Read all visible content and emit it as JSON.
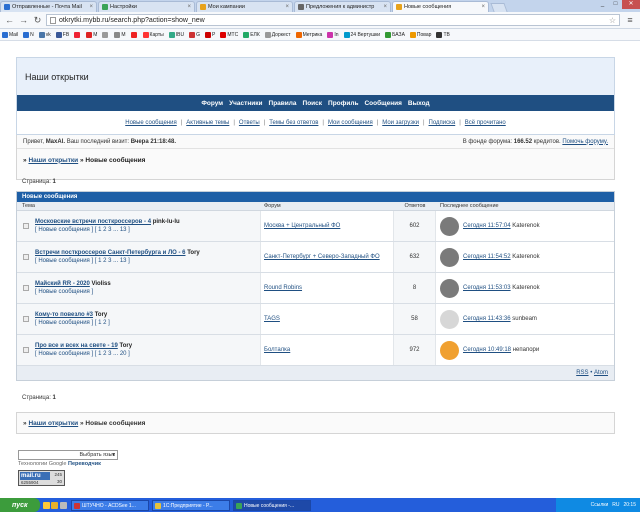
{
  "tabs": [
    {
      "label": "Отправленные - Почта Mail",
      "color": "#2a6ed1"
    },
    {
      "label": "Настройки",
      "color": "#3aa357"
    },
    {
      "label": "Мои кампании",
      "color": "#e7a21b"
    },
    {
      "label": "Предложения к администр",
      "color": "#666666"
    },
    {
      "label": "Новые сообщения",
      "color": "#e7a21b"
    }
  ],
  "address": "otkrytki.mybb.ru/search.php?action=show_new",
  "bookmarks": [
    {
      "label": "Mail",
      "color": "#2a6ed1"
    },
    {
      "label": "N",
      "color": "#2a6ed1"
    },
    {
      "label": "vk",
      "color": "#4a76a8"
    },
    {
      "label": "FB",
      "color": "#3b5998"
    },
    {
      "label": "",
      "color": "#e23"
    },
    {
      "label": "М",
      "color": "#d22"
    },
    {
      "label": "",
      "color": "#999"
    },
    {
      "label": "М",
      "color": "#888"
    },
    {
      "label": "",
      "color": "#e22"
    },
    {
      "label": "Карты",
      "color": "#f33"
    },
    {
      "label": "IBU",
      "color": "#3a8"
    },
    {
      "label": "G",
      "color": "#c33"
    },
    {
      "label": "P",
      "color": "#c00"
    },
    {
      "label": "MTC",
      "color": "#d00"
    },
    {
      "label": "ЕЛК",
      "color": "#2a6"
    },
    {
      "label": "Доркест",
      "color": "#999"
    },
    {
      "label": "Метрика",
      "color": "#e60"
    },
    {
      "label": "In",
      "color": "#c3a"
    },
    {
      "label": "24 Вертушки",
      "color": "#09c"
    },
    {
      "label": "БАЗА",
      "color": "#393"
    },
    {
      "label": "Повар",
      "color": "#e90"
    },
    {
      "label": "TB",
      "color": "#333"
    }
  ],
  "site": {
    "title": "Наши открытки",
    "menu": [
      "Форум",
      "Участники",
      "Правила",
      "Поиск",
      "Профиль",
      "Сообщения",
      "Выход"
    ],
    "submenu": [
      "Новые сообщения",
      "Активные темы",
      "Ответы",
      "Темы без ответов",
      "Мои сообщения",
      "Мои загрузки",
      "Подписка",
      "Всё прочитано"
    ]
  },
  "welcome": {
    "prefix": "Привет,",
    "user": "MaxAl.",
    "visit_label": "Ваш последний визит:",
    "visit": "Вчера 21:18:48.",
    "fund_label": "В фонде форума:",
    "fund": "166.52",
    "fund_suffix": "кредитов.",
    "help": "Помочь форуму."
  },
  "breadcrumb": {
    "home": "Наши открытки",
    "sep": "»",
    "current": "Новые сообщения"
  },
  "pager": {
    "label": "Страница:",
    "page": "1"
  },
  "table": {
    "title": "Новые сообщения",
    "columns": [
      "Тема",
      "Форум",
      "Ответов",
      "Последнее сообщение"
    ],
    "rows": [
      {
        "topic": "Московские встречи посткроссеров - 4",
        "author": "pink-lu-lu",
        "pages": "[ Новые сообщения ] [ 1 2 3 ... 13 ]",
        "forum": "Москва + Центральный ФО",
        "replies": "602",
        "last": "Сегодня 11:57:04",
        "last_user": "Katerenok",
        "avatar": "#7a7a7a"
      },
      {
        "topic": "Встречи посткроссеров Санкт-Петербурга и ЛО - 6",
        "author": "Tory",
        "pages": "[ Новые сообщения ] [ 1 2 3 ... 13 ]",
        "forum": "Санкт-Петербург + Северо-Западный ФО",
        "replies": "632",
        "last": "Сегодня 11:54:52",
        "last_user": "Katerenok",
        "avatar": "#7a7a7a"
      },
      {
        "topic": "Майский RR - 2020",
        "author": "Violiss",
        "pages": "[ Новые сообщения ]",
        "forum": "Round Robins",
        "replies": "8",
        "last": "Сегодня 11:53:03",
        "last_user": "Katerenok",
        "avatar": "#7a7a7a"
      },
      {
        "topic": "Кому-то повезло #3",
        "author": "Tory",
        "pages": "[ Новые сообщения ] [ 1 2 ]",
        "forum": "TAGS",
        "replies": "58",
        "last": "Сегодня 11:43:36",
        "last_user": "sunbeam",
        "avatar": "#d7d7d7"
      },
      {
        "topic": "Про все и всех на свете - 19",
        "author": "Tory",
        "pages": "[ Новые сообщения ] [ 1 2 3 ... 20 ]",
        "forum": "Болталка",
        "replies": "972",
        "last": "Сегодня 10:49:18",
        "last_user": "непапори",
        "avatar": "#f0a030"
      }
    ],
    "feeds": [
      "RSS",
      "Atom"
    ]
  },
  "footer": {
    "language": "Выбрать язык",
    "translate_prefix": "Технологии Google",
    "translate": "Переводчик",
    "counter_logo": "mail.ru",
    "counter_1": "245",
    "counter_2": "30",
    "counter_3": "6255904"
  },
  "taskbar": {
    "start": "пуск",
    "tasks": [
      {
        "label": "ШТУЧНО - ACDSee 1...",
        "color": "#c33"
      },
      {
        "label": "1С:Предприятие - Р...",
        "color": "#e8c23a"
      },
      {
        "label": "Новые сообщения -...",
        "color": "#3aa357"
      }
    ],
    "tray_search": "Ссылки",
    "lang": "RU",
    "clock": "20:15"
  }
}
